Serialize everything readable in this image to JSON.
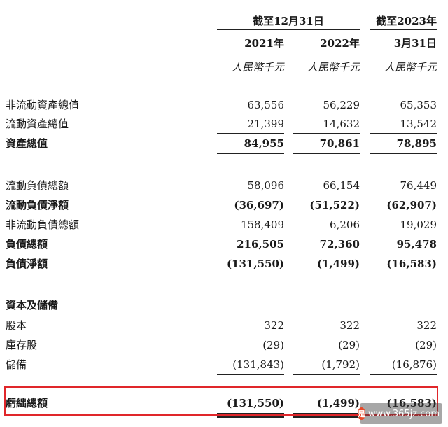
{
  "header": {
    "period_dec31": "截至12月31日",
    "period_mar31_top": "截至2023年",
    "col1_year": "2021年",
    "col2_year": "2022年",
    "col3_date": "3月31日",
    "unit": "人民幣千元"
  },
  "rows": {
    "non_current_assets": {
      "label": "非流動資產總值",
      "v": [
        "63,556",
        "56,229",
        "65,353"
      ]
    },
    "current_assets": {
      "label": "流動資產總值",
      "v": [
        "21,399",
        "14,632",
        "13,542"
      ]
    },
    "total_assets": {
      "label": "資產總值",
      "v": [
        "84,955",
        "70,861",
        "78,895"
      ]
    },
    "current_liabilities": {
      "label": "流動負債總額",
      "v": [
        "58,096",
        "66,154",
        "76,449"
      ]
    },
    "net_current_liabilities": {
      "label": "流動負債淨額",
      "v": [
        "(36,697)",
        "(51,522)",
        "(62,907)"
      ]
    },
    "non_current_liabilities": {
      "label": "非流動負債總額",
      "v": [
        "158,409",
        "6,206",
        "19,029"
      ]
    },
    "total_liabilities": {
      "label": "負債總額",
      "v": [
        "216,505",
        "72,360",
        "95,478"
      ]
    },
    "net_liabilities": {
      "label": "負債淨額",
      "v": [
        "(131,550)",
        "(1,499)",
        "(16,583)"
      ]
    },
    "capital_reserves": {
      "label": "資本及儲備"
    },
    "share_capital": {
      "label": "股本",
      "v": [
        "322",
        "322",
        "322"
      ]
    },
    "treasury_shares": {
      "label": "庫存股",
      "v": [
        "(29)",
        "(29)",
        "(29)"
      ]
    },
    "reserves": {
      "label": "儲備",
      "v": [
        "(131,843)",
        "(1,792)",
        "(16,876)"
      ]
    },
    "total_deficit": {
      "label": "虧絀總額",
      "v": [
        "(131,550)",
        "(1,499)",
        "(16,583)"
      ]
    }
  },
  "watermark": {
    "logo_text": "是",
    "text": "www.365jz.com"
  },
  "colors": {
    "highlight_border": "#e0262a",
    "text": "#1a1a1a"
  }
}
